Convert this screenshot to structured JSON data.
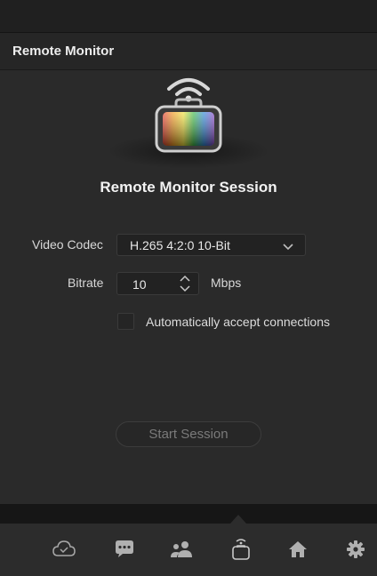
{
  "panel": {
    "title": "Remote Monitor"
  },
  "session": {
    "title": "Remote Monitor Session",
    "icon": "remote-monitor-app-icon"
  },
  "form": {
    "video_codec_label": "Video Codec",
    "video_codec_value": "H.265 4:2:0 10-Bit",
    "bitrate_label": "Bitrate",
    "bitrate_value": "10",
    "bitrate_unit": "Mbps",
    "auto_accept_label": "Automatically accept connections",
    "auto_accept_checked": false
  },
  "actions": {
    "start_session_label": "Start Session"
  },
  "tabbar": {
    "items": [
      {
        "icon": "cloud-check-icon"
      },
      {
        "icon": "chat-bubble-icon"
      },
      {
        "icon": "people-icon"
      },
      {
        "icon": "remote-monitor-tab-icon",
        "active": true
      },
      {
        "icon": "home-icon"
      },
      {
        "icon": "gear-icon"
      }
    ]
  },
  "colors": {
    "background": "#2a2a2a",
    "tabbar": "#2c2c2c",
    "text": "#e6e6e6",
    "icon": "#a8a8a8"
  }
}
